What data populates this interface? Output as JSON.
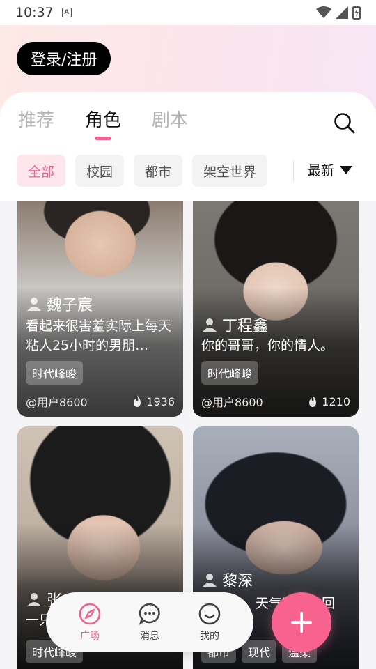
{
  "status": {
    "time": "10:37"
  },
  "header": {
    "login_label": "登录/注册"
  },
  "tabs": [
    {
      "label": "推荐",
      "active": false
    },
    {
      "label": "角色",
      "active": true
    },
    {
      "label": "剧本",
      "active": false
    }
  ],
  "filters": [
    {
      "label": "全部",
      "active": true
    },
    {
      "label": "校园",
      "active": false
    },
    {
      "label": "都市",
      "active": false
    },
    {
      "label": "架空世界",
      "active": false
    }
  ],
  "sort_label": "最新",
  "cards": [
    {
      "name": "魏子宸",
      "desc": "看起来很害羞实际上每天粘人25小时的男朋…",
      "tags": [
        "时代峰峻"
      ],
      "author": "@用户8600",
      "heat": "1936"
    },
    {
      "name": "丁程鑫",
      "desc": "你的哥哥，你的情人。",
      "tags": [
        "时代峰峻"
      ],
      "author": "@用户8600",
      "heat": "1210"
    },
    {
      "name": "张",
      "desc": "一只",
      "tags": [
        "时代峰峻"
      ],
      "author": "",
      "heat": ""
    },
    {
      "name": "黎深",
      "desc": "天气晴我的回",
      "tags": [
        "都市",
        "现代",
        "温柔"
      ],
      "author": "",
      "heat": ""
    }
  ],
  "nav": [
    {
      "label": "广场",
      "icon": "compass-icon",
      "active": true
    },
    {
      "label": "消息",
      "icon": "chat-icon",
      "active": false
    },
    {
      "label": "我的",
      "icon": "smile-icon",
      "active": false
    }
  ],
  "colors": {
    "accent": "#f06292",
    "fab": "#f7628f"
  }
}
